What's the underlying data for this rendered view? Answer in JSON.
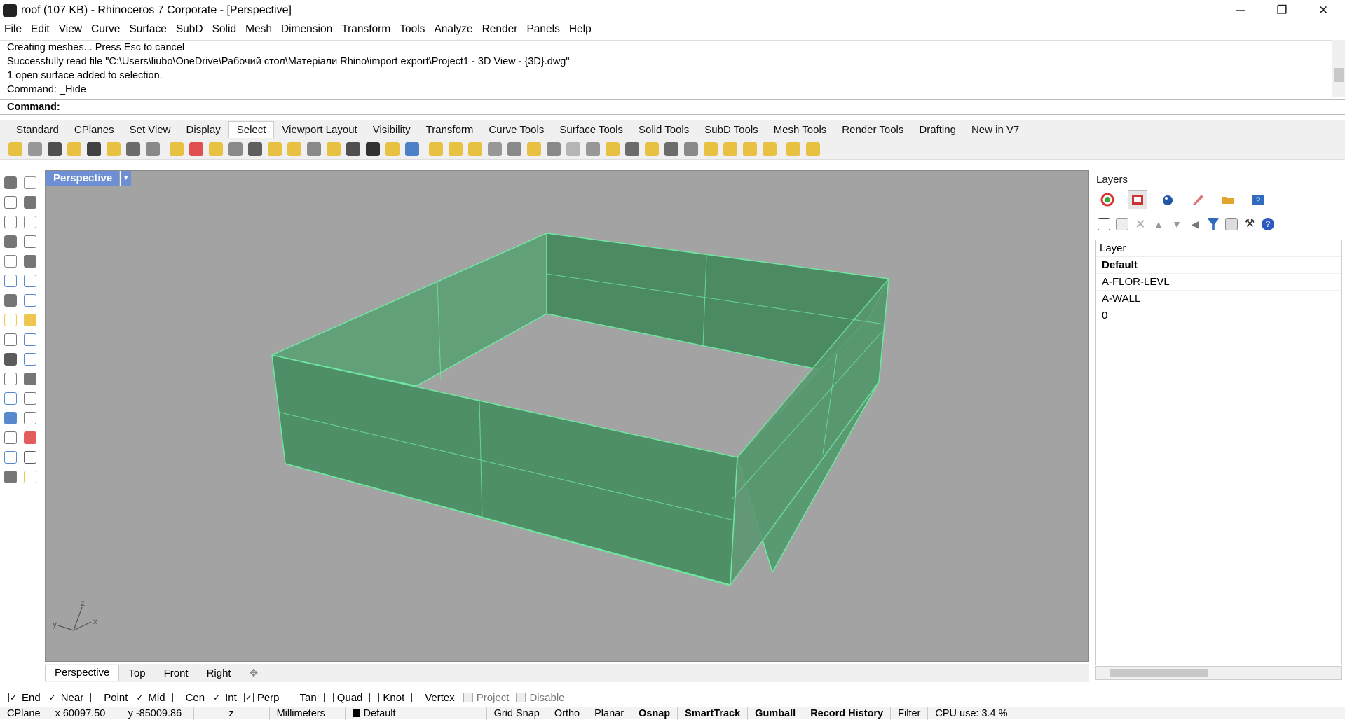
{
  "window": {
    "title": "roof (107 KB) - Rhinoceros 7 Corporate - [Perspective]",
    "controls": [
      "─",
      "❐",
      "✕"
    ]
  },
  "menu": [
    "File",
    "Edit",
    "View",
    "Curve",
    "Surface",
    "SubD",
    "Solid",
    "Mesh",
    "Dimension",
    "Transform",
    "Tools",
    "Analyze",
    "Render",
    "Panels",
    "Help"
  ],
  "command_history": {
    "lines": [
      "Creating meshes... Press Esc to cancel",
      "Successfully read file \"C:\\Users\\liubo\\OneDrive\\Рабочий стол\\Матеріали Rhino\\import export\\Project1 - 3D View - {3D}.dwg\"",
      "1 open surface added to selection.",
      "Command: _Hide"
    ],
    "prompt": "Command:"
  },
  "toolbar_tabs": [
    "Standard",
    "CPlanes",
    "Set View",
    "Display",
    "Select",
    "Viewport Layout",
    "Visibility",
    "Transform",
    "Curve Tools",
    "Surface Tools",
    "Solid Tools",
    "SubD Tools",
    "Mesh Tools",
    "Render Tools",
    "Drafting",
    "New in V7"
  ],
  "active_toolbar_tab": "Select",
  "viewport": {
    "name": "Perspective",
    "axis_labels": {
      "x": "x",
      "y": "y",
      "z": "z"
    },
    "tabs": [
      "Perspective",
      "Top",
      "Front",
      "Right"
    ],
    "add_tab": "✥"
  },
  "layers_panel": {
    "title": "Layers",
    "column_header": "Layer",
    "layers": [
      {
        "name": "Default",
        "current": true
      },
      {
        "name": "A-FLOR-LEVL",
        "current": false
      },
      {
        "name": "A-WALL",
        "current": false
      },
      {
        "name": "0",
        "current": false
      }
    ]
  },
  "osnaps": [
    {
      "label": "End",
      "checked": true,
      "enabled": true
    },
    {
      "label": "Near",
      "checked": true,
      "enabled": true
    },
    {
      "label": "Point",
      "checked": false,
      "enabled": true
    },
    {
      "label": "Mid",
      "checked": true,
      "enabled": true
    },
    {
      "label": "Cen",
      "checked": false,
      "enabled": true
    },
    {
      "label": "Int",
      "checked": true,
      "enabled": true
    },
    {
      "label": "Perp",
      "checked": true,
      "enabled": true
    },
    {
      "label": "Tan",
      "checked": false,
      "enabled": true
    },
    {
      "label": "Quad",
      "checked": false,
      "enabled": true
    },
    {
      "label": "Knot",
      "checked": false,
      "enabled": true
    },
    {
      "label": "Vertex",
      "checked": false,
      "enabled": true
    },
    {
      "label": "Project",
      "checked": false,
      "enabled": false
    },
    {
      "label": "Disable",
      "checked": false,
      "enabled": false
    }
  ],
  "status_bar": {
    "cplane": "CPlane",
    "x": "x 60097.50",
    "y": "y -85009.86",
    "z": "z",
    "units": "Millimeters",
    "layer": "Default",
    "toggles": [
      {
        "label": "Grid Snap",
        "bold": false
      },
      {
        "label": "Ortho",
        "bold": false
      },
      {
        "label": "Planar",
        "bold": false
      },
      {
        "label": "Osnap",
        "bold": true
      },
      {
        "label": "SmartTrack",
        "bold": true
      },
      {
        "label": "Gumball",
        "bold": true
      },
      {
        "label": "Record History",
        "bold": true
      },
      {
        "label": "Filter",
        "bold": false
      }
    ],
    "cpu": "CPU use: 3.4 %"
  },
  "colors": {
    "viewport_bg": "#a3a3a3",
    "wall_fill": "#4f8f68",
    "wall_edge": "#6ee8a0",
    "active_tab": "#6e8fd3"
  }
}
